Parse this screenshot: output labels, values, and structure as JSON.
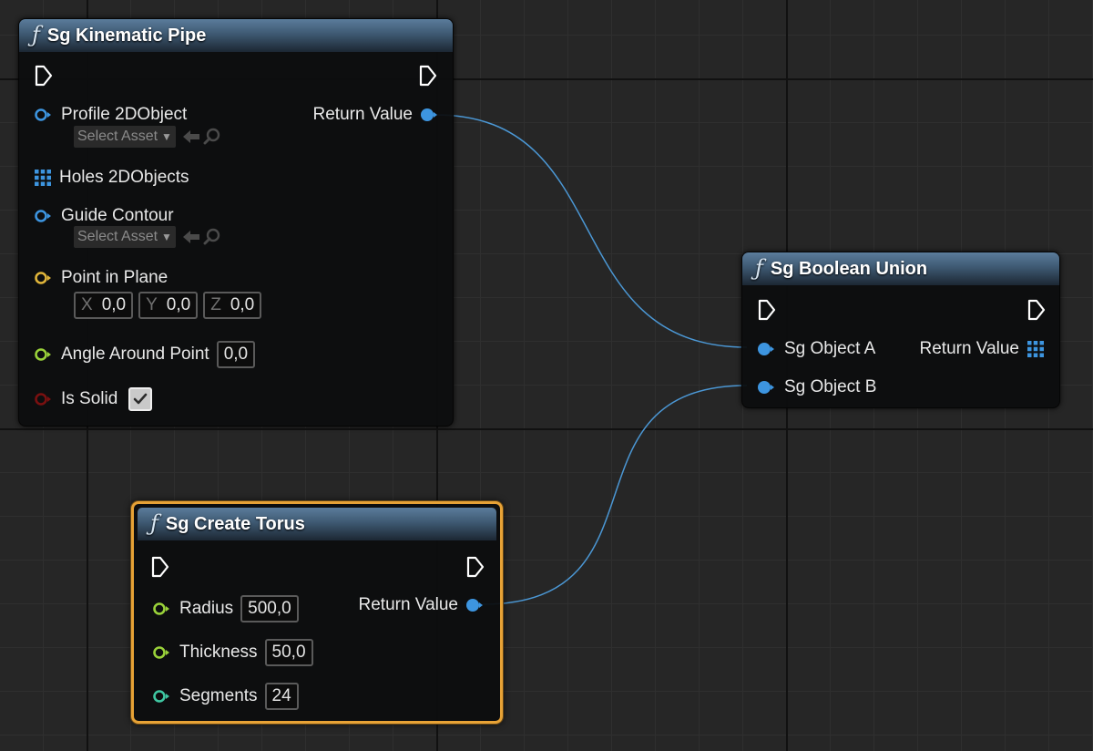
{
  "nodes": {
    "kinematic_pipe": {
      "title": "Sg Kinematic Pipe",
      "inputs": {
        "profile": {
          "label": "Profile 2DObject",
          "asset_placeholder": "Select Asset"
        },
        "holes": {
          "label": "Holes 2DObjects"
        },
        "guide": {
          "label": "Guide Contour",
          "asset_placeholder": "Select Asset"
        },
        "point": {
          "label": "Point in Plane",
          "x_axis": "X",
          "x": "0,0",
          "y_axis": "Y",
          "y": "0,0",
          "z_axis": "Z",
          "z": "0,0"
        },
        "angle": {
          "label": "Angle Around Point",
          "value": "0,0"
        },
        "solid": {
          "label": "Is Solid",
          "checked": true
        }
      },
      "output": {
        "label": "Return Value"
      }
    },
    "boolean_union": {
      "title": "Sg Boolean Union",
      "inputs": {
        "a": {
          "label": "Sg Object A"
        },
        "b": {
          "label": "Sg Object B"
        }
      },
      "output": {
        "label": "Return Value"
      }
    },
    "create_torus": {
      "title": "Sg Create Torus",
      "selected": true,
      "inputs": {
        "radius": {
          "label": "Radius",
          "value": "500,0"
        },
        "thickness": {
          "label": "Thickness",
          "value": "50,0"
        },
        "segments": {
          "label": "Segments",
          "value": "24"
        }
      },
      "output": {
        "label": "Return Value"
      }
    }
  },
  "colors": {
    "object_pin": "#3d95e0",
    "struct_pin": "#e0b53a",
    "float_pin": "#9ad23a",
    "int_pin": "#3fc7a2",
    "bool_pin": "#7a1010",
    "wire": "#4b97d4",
    "selection": "#e7a236"
  },
  "icons": {
    "function": "ƒ",
    "exec": "exec-pin-icon",
    "array": "array-grid-icon",
    "browse": "use-selected-arrow-icon",
    "search": "search-icon"
  }
}
